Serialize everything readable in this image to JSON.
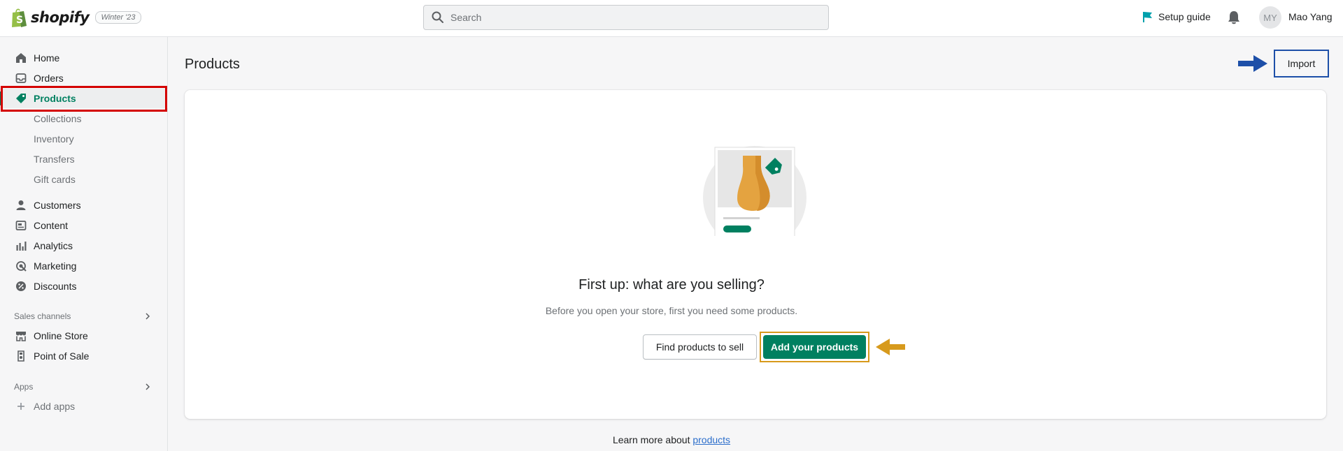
{
  "header": {
    "brand": "shopify",
    "edition": "Winter '23",
    "search_placeholder": "Search",
    "setup_guide": "Setup guide",
    "avatar_initials": "MY",
    "username": "Mao Yang"
  },
  "sidebar": {
    "items": [
      {
        "label": "Home",
        "icon": "home-icon"
      },
      {
        "label": "Orders",
        "icon": "inbox-icon"
      },
      {
        "label": "Products",
        "icon": "tag-icon",
        "active": true
      },
      {
        "label": "Collections"
      },
      {
        "label": "Inventory"
      },
      {
        "label": "Transfers"
      },
      {
        "label": "Gift cards"
      },
      {
        "label": "Customers",
        "icon": "person-icon"
      },
      {
        "label": "Content",
        "icon": "content-icon"
      },
      {
        "label": "Analytics",
        "icon": "bar-chart-icon"
      },
      {
        "label": "Marketing",
        "icon": "target-icon"
      },
      {
        "label": "Discounts",
        "icon": "discount-icon"
      }
    ],
    "sales_channels_label": "Sales channels",
    "channels": [
      {
        "label": "Online Store",
        "icon": "store-icon"
      },
      {
        "label": "Point of Sale",
        "icon": "pos-icon"
      }
    ],
    "apps_label": "Apps",
    "add_apps": "Add apps"
  },
  "main": {
    "title": "Products",
    "import_label": "Import",
    "empty_title": "First up: what are you selling?",
    "empty_subtitle": "Before you open your store, first you need some products.",
    "find_button": "Find products to sell",
    "add_button": "Add your products",
    "learn_prefix": "Learn more about",
    "learn_link": "products"
  },
  "colors": {
    "brand_green": "#008060",
    "highlight_red": "#d40000",
    "annotation_blue": "#1d4fa8",
    "annotation_orange": "#d79a1c"
  }
}
